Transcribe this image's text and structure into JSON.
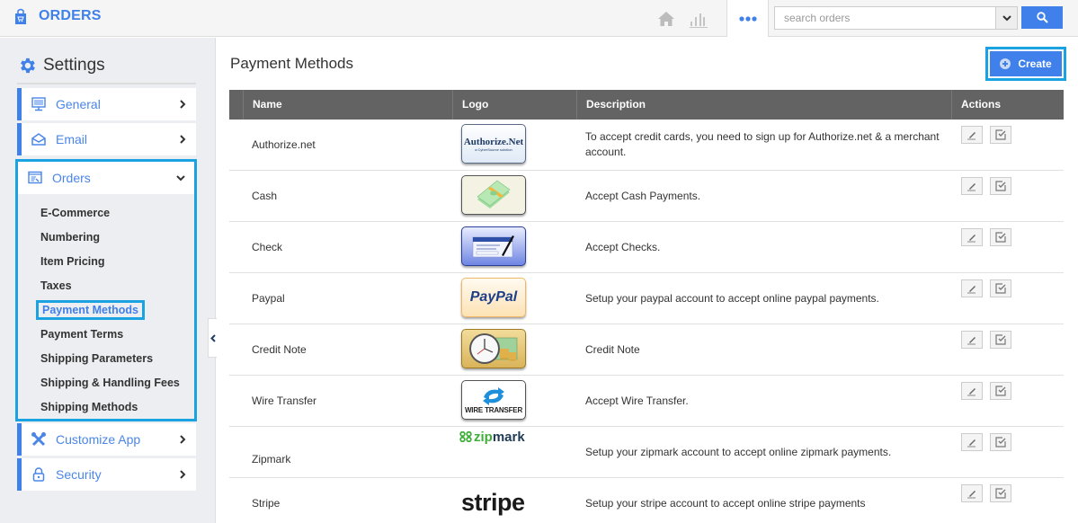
{
  "app": {
    "title": "ORDERS",
    "brand_icon": "shopping-bag-icon",
    "accent_color": "#3f80ea",
    "highlight_color": "#1aa3e0"
  },
  "topnav": {
    "icons": [
      "home-icon",
      "bar-chart-icon",
      "more-dots-icon"
    ],
    "search": {
      "placeholder": "search orders",
      "value": ""
    },
    "search_button_icon": "search-icon"
  },
  "sidebar": {
    "title": "Settings",
    "title_icon": "gear-icon",
    "items": [
      {
        "label": "General",
        "icon": "monitor-icon",
        "state": "collapsed"
      },
      {
        "label": "Email",
        "icon": "envelope-icon",
        "state": "collapsed"
      },
      {
        "label": "Orders",
        "icon": "orders-window-icon",
        "state": "expanded"
      },
      {
        "label": "Customize App",
        "icon": "tools-icon",
        "state": "collapsed"
      },
      {
        "label": "Security",
        "icon": "lock-icon",
        "state": "collapsed"
      }
    ],
    "orders_submenu": [
      {
        "label": "E-Commerce",
        "active": false
      },
      {
        "label": "Numbering",
        "active": false
      },
      {
        "label": "Item Pricing",
        "active": false
      },
      {
        "label": "Taxes",
        "active": false
      },
      {
        "label": "Payment Methods",
        "active": true
      },
      {
        "label": "Payment Terms",
        "active": false
      },
      {
        "label": "Shipping Parameters",
        "active": false
      },
      {
        "label": "Shipping & Handling Fees",
        "active": false
      },
      {
        "label": "Shipping Methods",
        "active": false
      }
    ]
  },
  "main": {
    "title": "Payment Methods",
    "create_label": "Create",
    "table": {
      "columns": [
        "Name",
        "Logo",
        "Description",
        "Actions"
      ],
      "rows": [
        {
          "name": "Authorize.net",
          "logo": "Authorize.Net",
          "logo_sub": "a CyberSource solution",
          "description": "To accept credit cards, you need to sign up for Authorize.net & a merchant account."
        },
        {
          "name": "Cash",
          "logo": "cash-stack",
          "description": "Accept Cash Payments."
        },
        {
          "name": "Check",
          "logo": "check",
          "description": "Accept Checks."
        },
        {
          "name": "Paypal",
          "logo": "PayPal",
          "description": "Setup your paypal account to accept online paypal payments."
        },
        {
          "name": "Credit Note",
          "logo": "clock-coins",
          "description": "Credit Note"
        },
        {
          "name": "Wire Transfer",
          "logo": "WIRE TRANSFER",
          "description": "Accept Wire Transfer."
        },
        {
          "name": "Zipmark",
          "logo": "zipmark",
          "description": "Setup your zipmark account to accept online zipmark payments."
        },
        {
          "name": "Stripe",
          "logo": "stripe",
          "description": "Setup your stripe account to accept online stripe payments"
        }
      ],
      "row_actions": [
        "edit-pencil-icon",
        "edit-check-icon"
      ]
    }
  }
}
